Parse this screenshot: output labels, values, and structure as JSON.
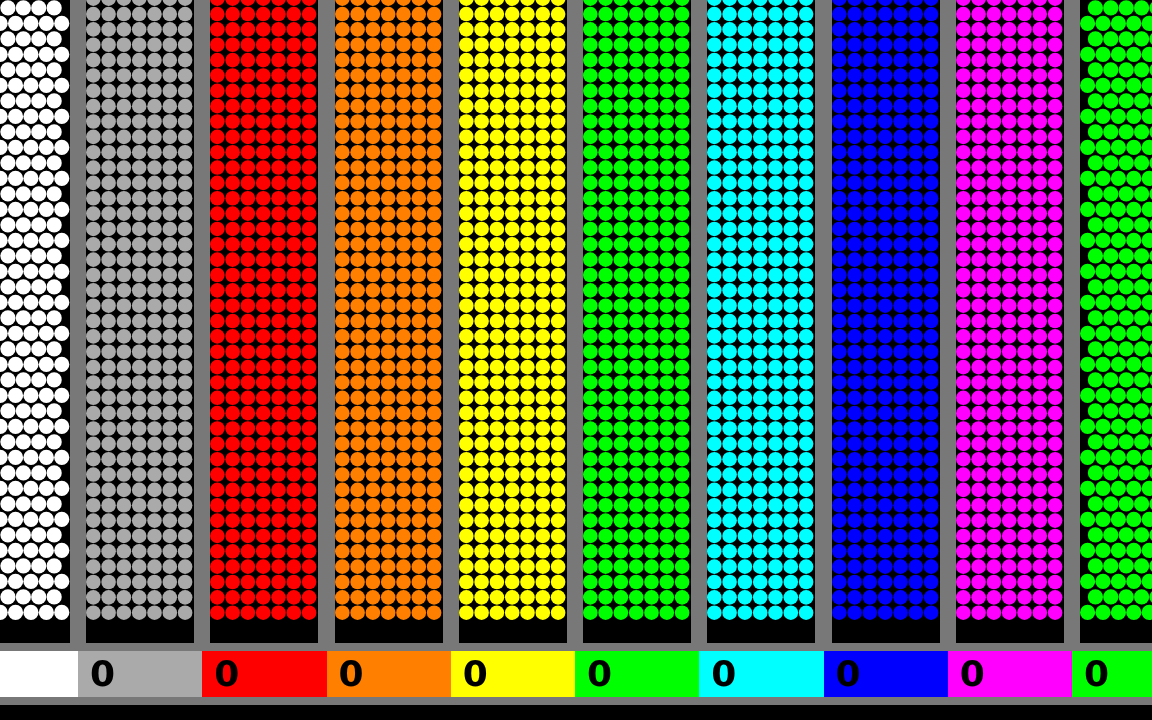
{
  "tubes": [
    {
      "kind": "hex",
      "color": "#ffffff"
    },
    {
      "kind": "grid",
      "color": "#aaaaaa",
      "counter": "0"
    },
    {
      "kind": "grid",
      "color": "#ff0000",
      "counter": "0"
    },
    {
      "kind": "grid",
      "color": "#ff7f00",
      "counter": "0"
    },
    {
      "kind": "grid",
      "color": "#ffff00",
      "counter": "0"
    },
    {
      "kind": "grid",
      "color": "#00ff00",
      "counter": "0"
    },
    {
      "kind": "grid",
      "color": "#00ffff",
      "counter": "0"
    },
    {
      "kind": "grid",
      "color": "#0000ff",
      "counter": "0"
    },
    {
      "kind": "grid",
      "color": "#ff00ff",
      "counter": "0"
    },
    {
      "kind": "hex",
      "color": "#00ff00",
      "counter": "0"
    }
  ]
}
